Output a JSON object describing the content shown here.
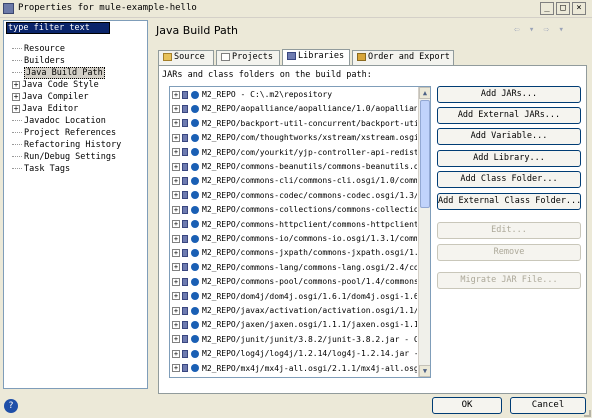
{
  "window": {
    "title": "Properties for mule-example-hello",
    "minimize": "_",
    "maximize": "□",
    "close": "×"
  },
  "sidebar": {
    "filter_value": "type filter text",
    "items": [
      {
        "label": "Resource",
        "expandable": false
      },
      {
        "label": "Builders",
        "expandable": false
      },
      {
        "label": "Java Build Path",
        "expandable": false,
        "selected": true
      },
      {
        "label": "Java Code Style",
        "expandable": true
      },
      {
        "label": "Java Compiler",
        "expandable": true
      },
      {
        "label": "Java Editor",
        "expandable": true
      },
      {
        "label": "Javadoc Location",
        "expandable": false
      },
      {
        "label": "Project References",
        "expandable": false
      },
      {
        "label": "Refactoring History",
        "expandable": false
      },
      {
        "label": "Run/Debug Settings",
        "expandable": false
      },
      {
        "label": "Task Tags",
        "expandable": false
      }
    ]
  },
  "main": {
    "title": "Java Build Path",
    "nav_arrows": "⇦ ▾ ⇨ ▾",
    "tabs": [
      {
        "label": "Source"
      },
      {
        "label": "Projects"
      },
      {
        "label": "Libraries"
      },
      {
        "label": "Order and Export"
      }
    ],
    "caption": "JARs and class folders on the build path:",
    "libraries": [
      "M2_REPO - C:\\.m2\\repository",
      "M2_REPO/aopalliance/aopalliance/1.0/aopalliance",
      "M2_REPO/backport-util-concurrent/backport-util",
      "M2_REPO/com/thoughtworks/xstream/xstream.osgi/",
      "M2_REPO/com/yourkit/yjp-controller-api-redist.",
      "M2_REPO/commons-beanutils/commons-beanutils.os",
      "M2_REPO/commons-cli/commons-cli.osgi/1.0/commo",
      "M2_REPO/commons-codec/commons-codec.osgi/1.3/c",
      "M2_REPO/commons-collections/commons-collection",
      "M2_REPO/commons-httpclient/commons-httpclient.",
      "M2_REPO/commons-io/commons-io.osgi/1.3.1/commo",
      "M2_REPO/commons-jxpath/commons-jxpath.osgi/1.2",
      "M2_REPO/commons-lang/commons-lang.osgi/2.4/com",
      "M2_REPO/commons-pool/commons-pool/1.4/commons-",
      "M2_REPO/dom4j/dom4j.osgi/1.6.1/dom4j.osgi-1.6.",
      "M2_REPO/javax/activation/activation.osgi/1.1/a",
      "M2_REPO/jaxen/jaxen.osgi/1.1.1/jaxen.osgi-1.1.",
      "M2_REPO/junit/junit/3.8.2/junit-3.8.2.jar - C:",
      "M2_REPO/log4j/log4j/1.2.14/log4j-1.2.14.jar -",
      "M2_REPO/mx4j/mx4j-all.osgi/2.1.1/mx4j-all.osgi"
    ],
    "buttons": {
      "add_jars": "Add JARs...",
      "add_external_jars": "Add External JARs...",
      "add_variable": "Add Variable...",
      "add_library": "Add Library...",
      "add_class_folder": "Add Class Folder...",
      "add_external_class_folder": "Add External Class Folder...",
      "edit": "Edit...",
      "remove": "Remove",
      "migrate_jar_file": "Migrate JAR File..."
    },
    "scroll_up": "▲",
    "scroll_down": "▼"
  },
  "footer": {
    "help": "?",
    "ok": "OK",
    "cancel": "Cancel"
  },
  "colors": {
    "window_bg": "#ece9d8",
    "selection_bg": "#0a246a",
    "jar_icon": "#6e7bb0",
    "classpath_dot": "#1a5fb4"
  }
}
